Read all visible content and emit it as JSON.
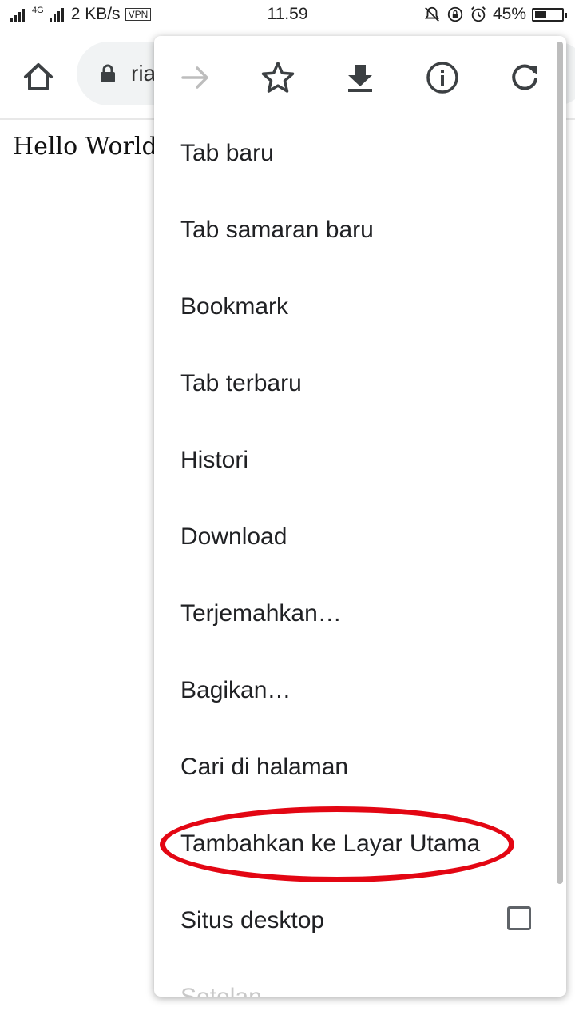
{
  "status_bar": {
    "network_label": "4G",
    "data_speed": "2 KB/s",
    "vpn": "VPN",
    "time": "11.59",
    "battery_percent": "45%",
    "battery_level": 0.45
  },
  "toolbar": {
    "url_fragment": "ria"
  },
  "page": {
    "content_text": "Hello World"
  },
  "menu": {
    "actions": [
      {
        "icon": "forward-arrow-icon",
        "enabled": false
      },
      {
        "icon": "star-icon",
        "enabled": true
      },
      {
        "icon": "download-icon",
        "enabled": true
      },
      {
        "icon": "info-icon",
        "enabled": true
      },
      {
        "icon": "refresh-icon",
        "enabled": true
      }
    ],
    "items": [
      {
        "label": "Tab baru"
      },
      {
        "label": "Tab samaran baru"
      },
      {
        "label": "Bookmark"
      },
      {
        "label": "Tab terbaru"
      },
      {
        "label": "Histori"
      },
      {
        "label": "Download"
      },
      {
        "label": "Terjemahkan…"
      },
      {
        "label": "Bagikan…"
      },
      {
        "label": "Cari di halaman"
      },
      {
        "label": "Tambahkan ke Layar Utama"
      },
      {
        "label": "Situs desktop",
        "checkbox": false
      },
      {
        "label": "Setelan"
      }
    ]
  },
  "colors": {
    "annotation": "#e30613",
    "icon": "#3c4043",
    "disabled_icon": "#bdbdbd"
  }
}
